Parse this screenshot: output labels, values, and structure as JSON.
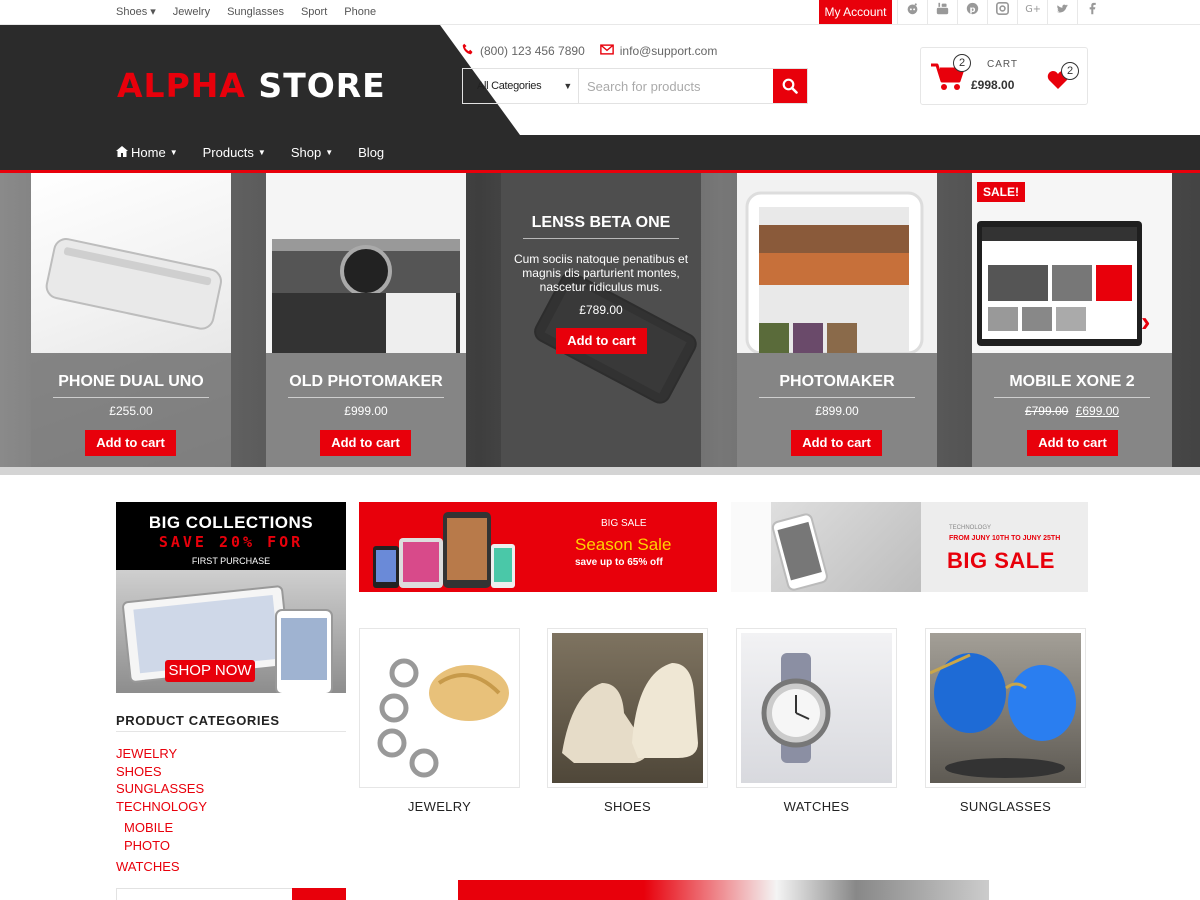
{
  "topbar": {
    "nav": [
      {
        "label": "Shoes ▾"
      },
      {
        "label": "Jewelry"
      },
      {
        "label": "Sunglasses"
      },
      {
        "label": "Sport"
      },
      {
        "label": "Phone"
      }
    ],
    "my_account": "My Account",
    "social_icons": [
      "reddit-icon",
      "youtube-icon",
      "pinterest-icon",
      "instagram-icon",
      "google-plus-icon",
      "twitter-icon",
      "facebook-icon"
    ]
  },
  "header": {
    "logo_alpha": "ALPHA",
    "logo_store": "STORE",
    "phone": "(800) 123 456 7890",
    "email": "info@support.com",
    "search": {
      "category": "All Categories",
      "placeholder": "Search for products"
    },
    "cart": {
      "label": "CART",
      "count": "2",
      "total": "£998.00"
    },
    "wishlist_count": "2"
  },
  "main_nav": [
    {
      "label": "Home",
      "has_dropdown": true
    },
    {
      "label": "Products",
      "has_dropdown": true
    },
    {
      "label": "Shop",
      "has_dropdown": true
    },
    {
      "label": "Blog",
      "has_dropdown": false
    }
  ],
  "slider": {
    "products": [
      {
        "title": "PHONE DUAL UNO",
        "price": "£255.00",
        "button": "Add to cart"
      },
      {
        "title": "OLD PHOTOMAKER",
        "price": "£999.00",
        "button": "Add to cart"
      },
      {
        "title": "LENSS BETA ONE",
        "description": "Cum sociis natoque penatibus et magnis dis parturient montes, nascetur ridiculus mus.",
        "price": "£789.00",
        "button": "Add to cart"
      },
      {
        "title": "PHOTOMAKER",
        "price": "£899.00",
        "button": "Add to cart"
      },
      {
        "title": "MOBILE XONE 2",
        "old_price": "£799.00",
        "price": "£699.00",
        "button": "Add to cart",
        "badge": "SALE!"
      }
    ]
  },
  "promo_left": {
    "line1": "BIG COLLECTIONS",
    "line2": "SAVE 20% FOR",
    "line3": "FIRST PURCHASE",
    "button": "SHOP NOW"
  },
  "banner_sale": {
    "small": "BIG SALE",
    "big": "Season Sale",
    "tiny": "save up to 65% off"
  },
  "banner_big": {
    "t1": "TECHNOLOGY",
    "t2": "FROM JUNY 10TH TO JUNY 25TH",
    "t3": "BIG SALE"
  },
  "categories": {
    "title": "PRODUCT CATEGORIES",
    "items": [
      {
        "label": "JEWELRY"
      },
      {
        "label": "SHOES"
      },
      {
        "label": "SUNGLASSES"
      },
      {
        "label": "TECHNOLOGY"
      },
      {
        "label": "MOBILE"
      },
      {
        "label": "PHOTO"
      },
      {
        "label": "WATCHES"
      }
    ]
  },
  "category_tiles": [
    {
      "label": "JEWELRY"
    },
    {
      "label": "SHOES"
    },
    {
      "label": "WATCHES"
    },
    {
      "label": "SUNGLASSES"
    }
  ],
  "colors": {
    "accent": "#e8000b",
    "header_dark": "#2b2b2b"
  }
}
